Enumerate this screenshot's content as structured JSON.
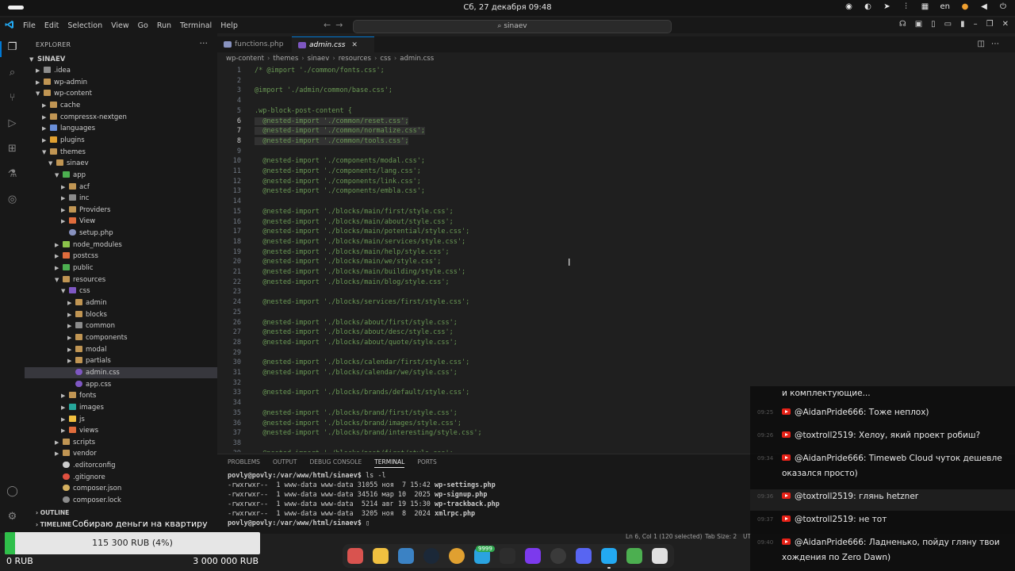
{
  "system_bar": {
    "clock": "Сб, 27 декабря  09:48",
    "layout": "en"
  },
  "menu": {
    "items": [
      "File",
      "Edit",
      "Selection",
      "View",
      "Go",
      "Run",
      "Terminal",
      "Help"
    ],
    "search": "sinaev"
  },
  "explorer": {
    "title": "EXPLORER",
    "root": "SINAEV",
    "outline": "OUTLINE",
    "timeline": "TIMELINE",
    "tree": [
      {
        "label": ".idea",
        "depth": 1,
        "type": "folder",
        "open": false,
        "color": "#8c8c8c"
      },
      {
        "label": "wp-admin",
        "depth": 1,
        "type": "folder",
        "open": false,
        "color": "#c09553"
      },
      {
        "label": "wp-content",
        "depth": 1,
        "type": "folder",
        "open": true,
        "color": "#c09553"
      },
      {
        "label": "cache",
        "depth": 2,
        "type": "folder",
        "open": false,
        "color": "#c09553"
      },
      {
        "label": "compressx-nextgen",
        "depth": 2,
        "type": "folder",
        "open": false,
        "color": "#c09553"
      },
      {
        "label": "languages",
        "depth": 2,
        "type": "folder",
        "open": false,
        "color": "#6a8fd8"
      },
      {
        "label": "plugins",
        "depth": 2,
        "type": "folder",
        "open": false,
        "color": "#e0a030"
      },
      {
        "label": "themes",
        "depth": 2,
        "type": "folder",
        "open": true,
        "color": "#c09553"
      },
      {
        "label": "sinaev",
        "depth": 3,
        "type": "folder",
        "open": true,
        "color": "#c09553"
      },
      {
        "label": "app",
        "depth": 4,
        "type": "folder",
        "open": true,
        "color": "#4caf50"
      },
      {
        "label": "acf",
        "depth": 5,
        "type": "folder",
        "open": false,
        "color": "#c09553"
      },
      {
        "label": "inc",
        "depth": 5,
        "type": "folder",
        "open": false,
        "color": "#8c8c8c"
      },
      {
        "label": "Providers",
        "depth": 5,
        "type": "folder",
        "open": false,
        "color": "#c09553"
      },
      {
        "label": "View",
        "depth": 5,
        "type": "folder",
        "open": false,
        "color": "#e06c3c"
      },
      {
        "label": "setup.php",
        "depth": 5,
        "type": "file",
        "open": false,
        "color": "#8892bf"
      },
      {
        "label": "node_modules",
        "depth": 4,
        "type": "folder",
        "open": false,
        "color": "#8bc34a"
      },
      {
        "label": "postcss",
        "depth": 4,
        "type": "folder",
        "open": false,
        "color": "#e06c3c"
      },
      {
        "label": "public",
        "depth": 4,
        "type": "folder",
        "open": false,
        "color": "#4caf50"
      },
      {
        "label": "resources",
        "depth": 4,
        "type": "folder",
        "open": true,
        "color": "#c09553"
      },
      {
        "label": "css",
        "depth": 5,
        "type": "folder",
        "open": true,
        "color": "#7e57c2"
      },
      {
        "label": "admin",
        "depth": 6,
        "type": "folder",
        "open": false,
        "color": "#c09553"
      },
      {
        "label": "blocks",
        "depth": 6,
        "type": "folder",
        "open": false,
        "color": "#c09553"
      },
      {
        "label": "common",
        "depth": 6,
        "type": "folder",
        "open": false,
        "color": "#8c8c8c"
      },
      {
        "label": "components",
        "depth": 6,
        "type": "folder",
        "open": false,
        "color": "#c09553"
      },
      {
        "label": "modal",
        "depth": 6,
        "type": "folder",
        "open": false,
        "color": "#c09553"
      },
      {
        "label": "partials",
        "depth": 6,
        "type": "folder",
        "open": false,
        "color": "#c09553"
      },
      {
        "label": "admin.css",
        "depth": 6,
        "type": "file",
        "open": false,
        "color": "#7e57c2",
        "selected": true
      },
      {
        "label": "app.css",
        "depth": 6,
        "type": "file",
        "open": false,
        "color": "#7e57c2"
      },
      {
        "label": "fonts",
        "depth": 5,
        "type": "folder",
        "open": false,
        "color": "#c09553"
      },
      {
        "label": "images",
        "depth": 5,
        "type": "folder",
        "open": false,
        "color": "#26a69a"
      },
      {
        "label": "js",
        "depth": 5,
        "type": "folder",
        "open": false,
        "color": "#f0c040"
      },
      {
        "label": "views",
        "depth": 5,
        "type": "folder",
        "open": false,
        "color": "#e06c3c"
      },
      {
        "label": "scripts",
        "depth": 4,
        "type": "folder",
        "open": false,
        "color": "#c09553"
      },
      {
        "label": "vendor",
        "depth": 4,
        "type": "folder",
        "open": false,
        "color": "#c09553"
      },
      {
        "label": ".editorconfig",
        "depth": 4,
        "type": "file",
        "open": false,
        "color": "#cccccc"
      },
      {
        "label": ".gitignore",
        "depth": 4,
        "type": "file",
        "open": false,
        "color": "#e05040"
      },
      {
        "label": "composer.json",
        "depth": 4,
        "type": "file",
        "open": false,
        "color": "#d4b060"
      },
      {
        "label": "composer.lock",
        "depth": 4,
        "type": "file",
        "open": false,
        "color": "#8c8c8c"
      }
    ]
  },
  "tabs": [
    {
      "label": "functions.php",
      "color": "#8892bf",
      "active": false
    },
    {
      "label": "admin.css",
      "color": "#7e57c2",
      "active": true
    }
  ],
  "breadcrumb": [
    "wp-content",
    "themes",
    "sinaev",
    "resources",
    "css",
    "admin.css"
  ],
  "editor": {
    "lines": [
      {
        "n": "1",
        "text": "/* @import './common/fonts.css';"
      },
      {
        "n": "2",
        "text": ""
      },
      {
        "n": "3",
        "text": "@import './admin/common/base.css';"
      },
      {
        "n": "4",
        "text": ""
      },
      {
        "n": "5",
        "text": ".wp-block-post-content {"
      },
      {
        "n": "6",
        "text": "  @nested-import './common/reset.css';",
        "sel": true
      },
      {
        "n": "7",
        "text": "  @nested-import './common/normalize.css';",
        "sel": true
      },
      {
        "n": "8",
        "text": "  @nested-import './common/tools.css';",
        "sel": true
      },
      {
        "n": "9",
        "text": ""
      },
      {
        "n": "10",
        "text": "  @nested-import './components/modal.css';"
      },
      {
        "n": "11",
        "text": "  @nested-import './components/lang.css';"
      },
      {
        "n": "12",
        "text": "  @nested-import './components/link.css';"
      },
      {
        "n": "13",
        "text": "  @nested-import './components/embla.css';"
      },
      {
        "n": "14",
        "text": ""
      },
      {
        "n": "15",
        "text": "  @nested-import './blocks/main/first/style.css';"
      },
      {
        "n": "16",
        "text": "  @nested-import './blocks/main/about/style.css';"
      },
      {
        "n": "17",
        "text": "  @nested-import './blocks/main/potential/style.css';"
      },
      {
        "n": "18",
        "text": "  @nested-import './blocks/main/services/style.css';"
      },
      {
        "n": "19",
        "text": "  @nested-import './blocks/main/help/style.css';"
      },
      {
        "n": "20",
        "text": "  @nested-import './blocks/main/we/style.css';"
      },
      {
        "n": "21",
        "text": "  @nested-import './blocks/main/building/style.css';"
      },
      {
        "n": "22",
        "text": "  @nested-import './blocks/main/blog/style.css';"
      },
      {
        "n": "23",
        "text": ""
      },
      {
        "n": "24",
        "text": "  @nested-import './blocks/services/first/style.css';"
      },
      {
        "n": "25",
        "text": ""
      },
      {
        "n": "26",
        "text": "  @nested-import './blocks/about/first/style.css';"
      },
      {
        "n": "27",
        "text": "  @nested-import './blocks/about/desc/style.css';"
      },
      {
        "n": "28",
        "text": "  @nested-import './blocks/about/quote/style.css';"
      },
      {
        "n": "29",
        "text": ""
      },
      {
        "n": "30",
        "text": "  @nested-import './blocks/calendar/first/style.css';"
      },
      {
        "n": "31",
        "text": "  @nested-import './blocks/calendar/we/style.css';"
      },
      {
        "n": "32",
        "text": ""
      },
      {
        "n": "33",
        "text": "  @nested-import './blocks/brands/default/style.css';"
      },
      {
        "n": "34",
        "text": ""
      },
      {
        "n": "35",
        "text": "  @nested-import './blocks/brand/first/style.css';"
      },
      {
        "n": "36",
        "text": "  @nested-import './blocks/brand/images/style.css';"
      },
      {
        "n": "37",
        "text": "  @nested-import './blocks/brand/interesting/style.css';"
      },
      {
        "n": "38",
        "text": ""
      },
      {
        "n": "39",
        "text": "  @nested-import './blocks/post/first/style.css';"
      }
    ]
  },
  "panel": {
    "tabs": [
      "PROBLEMS",
      "OUTPUT",
      "DEBUG CONSOLE",
      "TERMINAL",
      "PORTS"
    ],
    "active_tab": "TERMINAL",
    "terminal": [
      {
        "prompt": "povly@povly:/var/www/html/sinaev$",
        "text": " ls -l"
      },
      {
        "text": "-rwxrwxr--  1 www-data www-data 31055 ноя  7 15:42 ",
        "file": "wp-settings.php"
      },
      {
        "text": "-rwxrwxr--  1 www-data www-data 34516 мар 10  2025 ",
        "file": "wp-signup.php"
      },
      {
        "text": "-rwxrwxr--  1 www-data www-data  5214 авг 19 15:30 ",
        "file": "wp-trackback.php"
      },
      {
        "text": "-rwxrwxr--  1 www-data www-data  3205 ноя  8  2024 ",
        "file": "xmlrpc.php"
      },
      {
        "prompt": "povly@povly:/var/www/html/sinaev$",
        "text": " ▯"
      }
    ]
  },
  "status": {
    "position": "Ln 6, Col 1 (120 selected)",
    "tab_size": "Tab Size: 2",
    "encoding": "UT"
  },
  "chat": {
    "messages": [
      {
        "ts": "",
        "user": "",
        "text": "и комплектующие..."
      },
      {
        "ts": "09:25",
        "user": "@AidanPride666:",
        "text": "Тоже неплох)"
      },
      {
        "ts": "09:26",
        "user": "@toxtroll2519:",
        "text": "Хелоу, який проект робиш?"
      },
      {
        "ts": "09:34",
        "user": "@AidanPride666:",
        "text": "Timeweb Cloud чуток дешевле оказался просто)"
      },
      {
        "ts": "09:36",
        "user": "@toxtroll2519:",
        "text": "глянь hetzner"
      },
      {
        "ts": "09:37",
        "user": "@toxtroll2519:",
        "text": "не тот"
      },
      {
        "ts": "09:40",
        "user": "@AidanPride666:",
        "text": "Ладненько, пойду гляну твои хождения по Zero Dawn)"
      }
    ]
  },
  "donation": {
    "goal": "Собираю деньги на квартиру",
    "current": "115 300 RUB (4%)",
    "progress": 0.04,
    "min": "0 RUB",
    "max": "3 000 000 RUB"
  },
  "dock": {
    "badge": "9999",
    "apps": [
      {
        "name": "files-icon",
        "color": "#d9534f"
      },
      {
        "name": "rhythmbox-icon",
        "color": "#f0c040"
      },
      {
        "name": "text-editor-icon",
        "color": "#3b82c4"
      },
      {
        "name": "steam-icon",
        "color": "#1b2838"
      },
      {
        "name": "chrome-icon",
        "color": "#e0a030"
      },
      {
        "name": "telegram-icon",
        "color": "#2aa3e0"
      },
      {
        "name": "terminal-icon",
        "color": "#2d2d2d"
      },
      {
        "name": "obsidian-icon",
        "color": "#7c3aed"
      },
      {
        "name": "obs-icon",
        "color": "#3a3a3a"
      },
      {
        "name": "discord-icon",
        "color": "#5865f2"
      },
      {
        "name": "vscode-icon",
        "color": "#23a9f2"
      },
      {
        "name": "trash-icon",
        "color": "#4caf50"
      },
      {
        "name": "app-grid-icon",
        "color": "#e0e0e0"
      }
    ]
  }
}
